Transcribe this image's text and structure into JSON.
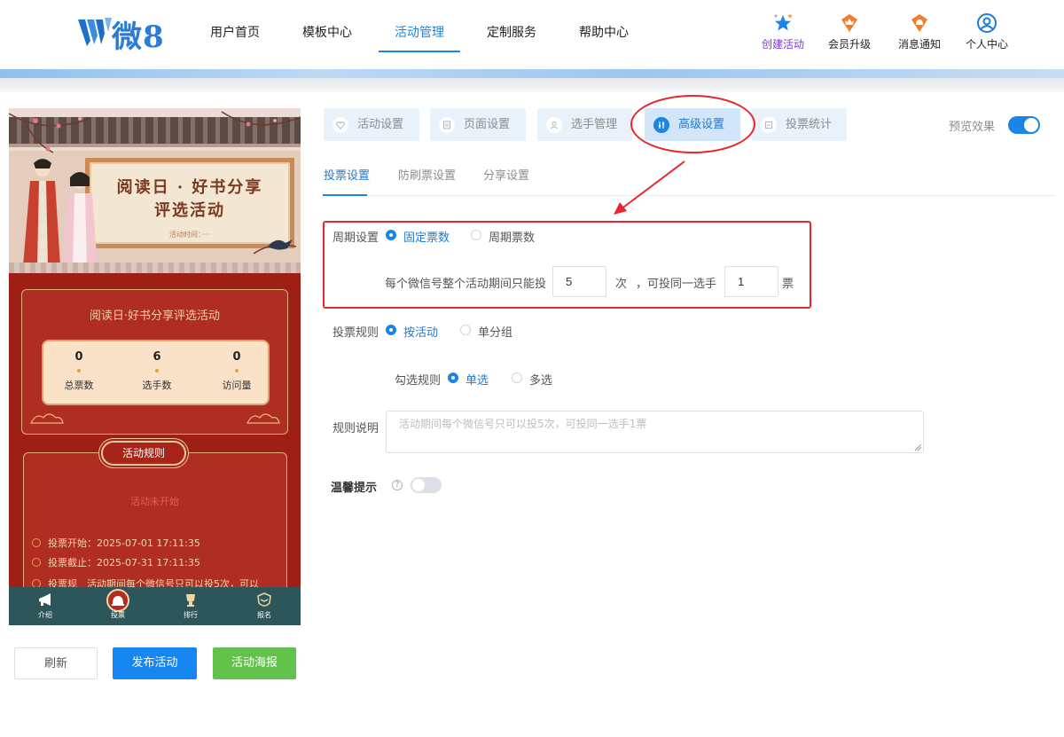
{
  "header": {
    "logo_text": "微8",
    "nav": [
      "用户首页",
      "模板中心",
      "活动管理",
      "定制服务",
      "帮助中心"
    ],
    "active_nav": "活动管理",
    "tools": [
      {
        "label": "创建活动",
        "icon": "stars-icon"
      },
      {
        "label": "会员升级",
        "icon": "crown-badge-icon"
      },
      {
        "label": "消息通知",
        "icon": "bell-badge-icon"
      },
      {
        "label": "个人中心",
        "icon": "user-circle-icon"
      }
    ]
  },
  "preview": {
    "banner_title_line1": "阅读日 · 好书分享",
    "banner_title_line2": "评选活动",
    "banner_subtitle": "活动时间：····",
    "info_title": "阅读日·好书分享评选活动",
    "stats": [
      {
        "value": "0",
        "label": "总票数"
      },
      {
        "value": "6",
        "label": "选手数"
      },
      {
        "value": "0",
        "label": "访问量"
      }
    ],
    "rules_tag": "活动规则",
    "rules_status": "活动未开始",
    "rule_lines": [
      "投票开始：2025-07-01 17:11:35",
      "投票截止：2025-07-31 17:11:35",
      "投票规　活动期间每个微信号只可以投5次，可以"
    ],
    "tabs": [
      {
        "label": "介绍",
        "icon": "megaphone-icon"
      },
      {
        "label": "投票",
        "icon": "vote-bell-icon"
      },
      {
        "label": "排行",
        "icon": "trophy-icon"
      },
      {
        "label": "报名",
        "icon": "signup-shield-icon"
      }
    ]
  },
  "actions": {
    "refresh": "刷新",
    "publish": "发布活动",
    "poster": "活动海报",
    "colors": {
      "publish": "#1687f0",
      "poster": "#62c24b"
    }
  },
  "settings": {
    "section_tabs": [
      {
        "label": "活动设置",
        "icon": "heart-icon"
      },
      {
        "label": "页面设置",
        "icon": "page-icon"
      },
      {
        "label": "选手管理",
        "icon": "person-icon"
      },
      {
        "label": "高级设置",
        "icon": "sliders-icon"
      },
      {
        "label": "投票统计",
        "icon": "chart-icon"
      }
    ],
    "active_section": "高级设置",
    "preview_label": "预览效果",
    "preview_enabled": true,
    "sub_tabs": [
      "投票设置",
      "防刷票设置",
      "分享设置"
    ],
    "active_sub_tab": "投票设置",
    "period": {
      "label": "周期设置",
      "options": [
        "固定票数",
        "周期票数"
      ],
      "selected": "固定票数",
      "sentence_prefix": "每个微信号整个活动期间只能投",
      "times_value": "5",
      "times_unit": "次",
      "mid_text": "，可投同一选手",
      "per_player_value": "1",
      "per_player_unit": "票"
    },
    "vote_rule": {
      "label": "投票规则",
      "options": [
        "按活动",
        "单分组"
      ],
      "selected": "按活动"
    },
    "check_rule": {
      "label": "勾选规则",
      "options": [
        "单选",
        "多选"
      ],
      "selected": "单选"
    },
    "rule_desc": {
      "label": "规则说明",
      "placeholder": "活动期间每个微信号只可以投5次，可投同一选手1票"
    },
    "tip": {
      "label": "温馨提示",
      "help": "?",
      "enabled": false
    }
  },
  "annotation_color": "#e8262b"
}
